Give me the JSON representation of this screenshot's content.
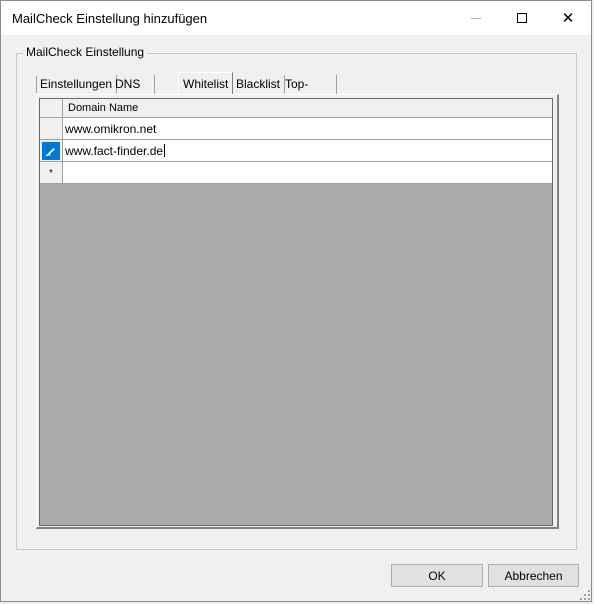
{
  "window": {
    "title": "MailCheck Einstellung hinzufügen",
    "controls": {
      "close_glyph": "✕"
    }
  },
  "group": {
    "label": "MailCheck Einstellung"
  },
  "tabs": [
    {
      "label": "Einstellungen",
      "active": false
    },
    {
      "label": "DNS Server",
      "active": false
    },
    {
      "label": "Whitelist",
      "active": true
    },
    {
      "label": "Blacklist",
      "active": false
    },
    {
      "label": "Top-Level Domains",
      "active": false
    }
  ],
  "grid": {
    "columns": [
      "Domain Name"
    ],
    "rows": [
      {
        "domain": "www.omikron.net",
        "state": "normal"
      },
      {
        "domain": "www.fact-finder.de",
        "state": "editing",
        "row_icon": "pencil-icon"
      },
      {
        "domain": "",
        "state": "new",
        "row_icon": "new-row-star-icon",
        "glyph": "*"
      }
    ],
    "colors": {
      "empty_area": "#ababab",
      "edit_indicator": "#0078d7"
    }
  },
  "buttons": {
    "ok": "OK",
    "cancel": "Abbrechen"
  }
}
